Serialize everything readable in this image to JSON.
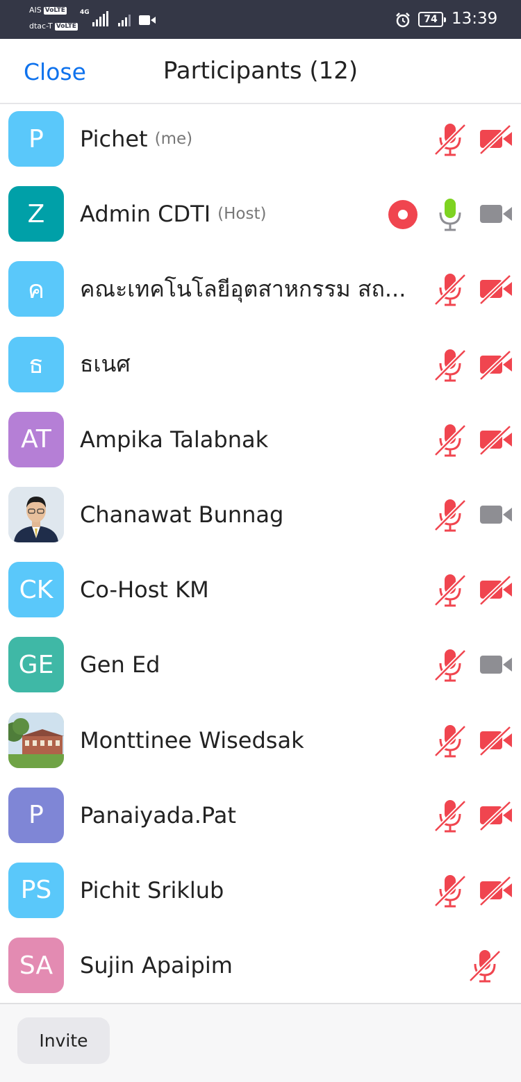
{
  "status_bar": {
    "carrier1": "AIS",
    "carrier2": "dtac-T",
    "volte": "VoLTE",
    "network": "4G",
    "battery": "74",
    "time": "13:39"
  },
  "header": {
    "close_label": "Close",
    "title": "Participants (12)"
  },
  "participants": [
    {
      "initials": "P",
      "name": "Pichet",
      "role": "(me)",
      "avatar_color": "#5ac8fa",
      "mic": "muted",
      "video": "off"
    },
    {
      "initials": "Z",
      "name": "Admin CDTI",
      "role": "(Host)",
      "avatar_color": "#00a0a8",
      "mic": "active",
      "video": "idle",
      "recording": true
    },
    {
      "initials": "ค",
      "name": "คณะเทคโนโลยีอุตสาหกรรม สถ...",
      "role": "",
      "avatar_color": "#5ac8fa",
      "mic": "muted",
      "video": "off"
    },
    {
      "initials": "ธ",
      "name": "ธเนศ",
      "role": "",
      "avatar_color": "#5ac8fa",
      "mic": "muted",
      "video": "off"
    },
    {
      "initials": "AT",
      "name": "Ampika Talabnak",
      "role": "",
      "avatar_color": "#b57fd6",
      "mic": "muted",
      "video": "off"
    },
    {
      "initials": "",
      "name": "Chanawat Bunnag",
      "role": "",
      "avatar_color": "#dde6ee",
      "avatar_image": "portrait",
      "mic": "muted",
      "video": "idle"
    },
    {
      "initials": "CK",
      "name": "Co-Host KM",
      "role": "",
      "avatar_color": "#5ac8fa",
      "mic": "muted",
      "video": "off"
    },
    {
      "initials": "GE",
      "name": "Gen Ed",
      "role": "",
      "avatar_color": "#3fb8a6",
      "mic": "muted",
      "video": "idle"
    },
    {
      "initials": "",
      "name": "Monttinee Wisedsak",
      "role": "",
      "avatar_color": "#a9c98a",
      "avatar_image": "building",
      "mic": "muted",
      "video": "off"
    },
    {
      "initials": "P",
      "name": "Panaiyada.Pat",
      "role": "",
      "avatar_color": "#7f86d6",
      "mic": "muted",
      "video": "off"
    },
    {
      "initials": "PS",
      "name": "Pichit Sriklub",
      "role": "",
      "avatar_color": "#5ac8fa",
      "mic": "muted",
      "video": "off"
    },
    {
      "initials": "SA",
      "name": "Sujin Apaipim",
      "role": "",
      "avatar_color": "#e38bb2",
      "mic": "muted",
      "video": "none"
    }
  ],
  "footer": {
    "invite_label": "Invite"
  },
  "colors": {
    "accent": "#0e72ed",
    "muted_red": "#f0454f",
    "mic_active": "#7ed321",
    "icon_gray": "#8e8e93"
  }
}
